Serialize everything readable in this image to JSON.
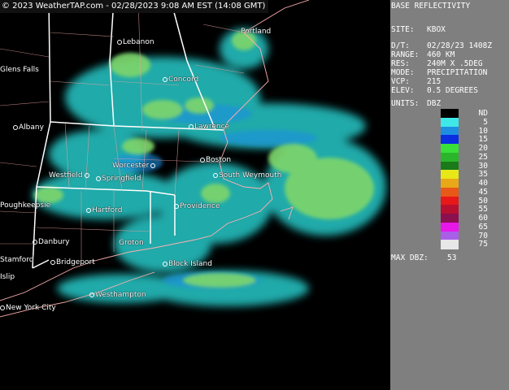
{
  "banner": "© 2023 WeatherTAP.com - 02/28/2023  9:08 AM EST (14:08 GMT)",
  "panel": {
    "title": "BASE REFLECTIVITY",
    "site_label": "SITE:",
    "site": "KBOX",
    "dt_label": "D/T:",
    "dt": "02/28/23 1408Z",
    "range_label": "RANGE:",
    "range": "460 KM",
    "res_label": "RES:",
    "res": "240M X .5DEG",
    "mode_label": "MODE:",
    "mode": "PRECIPITATION",
    "vcp_label": "VCP:",
    "vcp": "215",
    "elev_label": "ELEV:",
    "elev": "0.5 DEGREES",
    "units_label": "UNITS:",
    "units": "DBZ",
    "max_label": "MAX DBZ:",
    "max": "53"
  },
  "legend": {
    "labels": [
      "ND",
      "5",
      "10",
      "15",
      "20",
      "25",
      "30",
      "35",
      "40",
      "45",
      "50",
      "55",
      "60",
      "65",
      "70",
      "75"
    ],
    "colors": [
      "#000000",
      "#3fe8e8",
      "#1e8fe0",
      "#0a2ee0",
      "#38e038",
      "#2bb52b",
      "#1a7a1a",
      "#e8e818",
      "#e8a818",
      "#e85818",
      "#e81818",
      "#b81030",
      "#8a1050",
      "#e818e8",
      "#a860e8",
      "#e8e8e8"
    ]
  },
  "cities": [
    {
      "name": "Portland"
    },
    {
      "name": "Lebanon"
    },
    {
      "name": "Glens Falls"
    },
    {
      "name": "Concord"
    },
    {
      "name": "Albany"
    },
    {
      "name": "Lawrence"
    },
    {
      "name": "Worcester"
    },
    {
      "name": "Boston"
    },
    {
      "name": "Westfield"
    },
    {
      "name": "Springfield"
    },
    {
      "name": "South Weymouth"
    },
    {
      "name": "Poughkeepsie"
    },
    {
      "name": "Hartford"
    },
    {
      "name": "Providence"
    },
    {
      "name": "Danbury"
    },
    {
      "name": "Groton"
    },
    {
      "name": "Stamford"
    },
    {
      "name": "Bridgeport"
    },
    {
      "name": "Block Island"
    },
    {
      "name": "Islip"
    },
    {
      "name": "Westhampton"
    },
    {
      "name": "New York City"
    }
  ]
}
